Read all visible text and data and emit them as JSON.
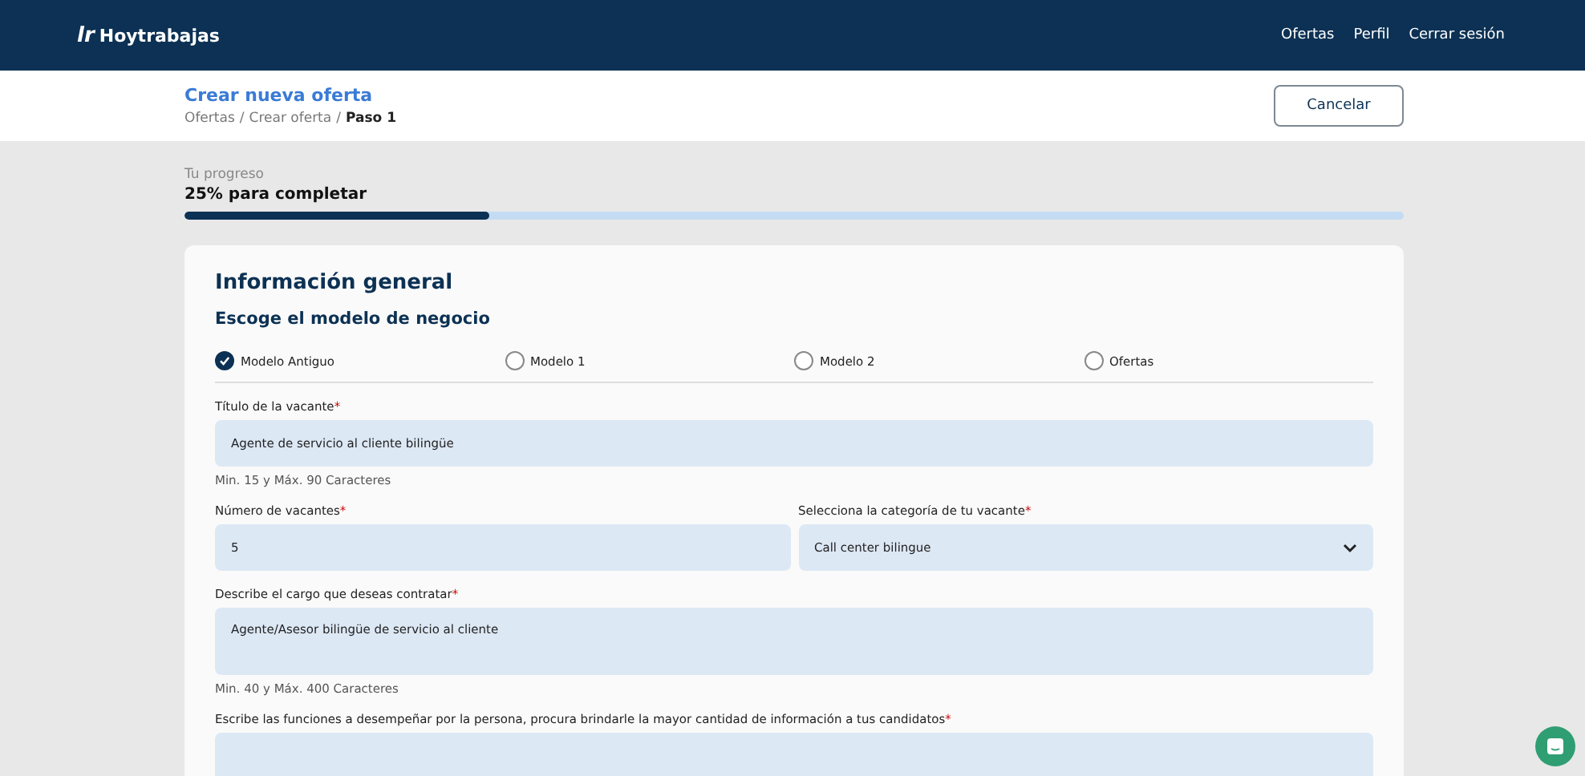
{
  "header": {
    "logo_mark": "lr",
    "brand": "Hoytrabajas",
    "nav": [
      {
        "label": "Ofertas"
      },
      {
        "label": "Perfil"
      },
      {
        "label": "Cerrar sesión"
      }
    ]
  },
  "subheader": {
    "title": "Crear nueva oferta",
    "separator": "/",
    "breadcrumb": [
      {
        "label": "Ofertas",
        "current": false
      },
      {
        "label": "Crear oferta",
        "current": false
      },
      {
        "label": "Paso 1",
        "current": true
      }
    ],
    "cancel": "Cancelar"
  },
  "progress": {
    "caption": "Tu progreso",
    "label": "25% para completar",
    "level": 0.25
  },
  "card": {
    "title": "Información general",
    "subtitle": "Escoge el modelo de negocio",
    "models": [
      {
        "label": "Modelo Antiguo",
        "selected": true
      },
      {
        "label": "Modelo 1",
        "selected": false
      },
      {
        "label": "Modelo 2",
        "selected": false
      },
      {
        "label": "Ofertas",
        "selected": false
      }
    ],
    "rows": [
      {
        "fields": [
          {
            "kind": "input",
            "label": "Título de la vacante",
            "required_mark": "*",
            "value": "Agente de servicio al cliente bilingüe",
            "hint": "Min. 15 y Máx. 90 Caracteres"
          }
        ]
      },
      {
        "fields": [
          {
            "kind": "input",
            "label": "Número de vacantes",
            "required_mark": "*",
            "value": "5"
          },
          {
            "kind": "select",
            "label": "Selecciona la categoría de tu vacante",
            "required_mark": "*",
            "value": "Call center bilingue"
          }
        ]
      },
      {
        "fields": [
          {
            "kind": "textarea",
            "label": "Describe el cargo que deseas contratar",
            "required_mark": "*",
            "value": "Agente/Asesor bilingüe de servicio al cliente",
            "hint": "Min. 40 y Máx. 400 Caracteres"
          }
        ]
      },
      {
        "fields": [
          {
            "kind": "textarea",
            "label": "Escribe las funciones a desempeñar por la persona, procura brindarle la mayor cantidad de información a tus candidatos",
            "required_mark": "*"
          }
        ]
      }
    ]
  }
}
